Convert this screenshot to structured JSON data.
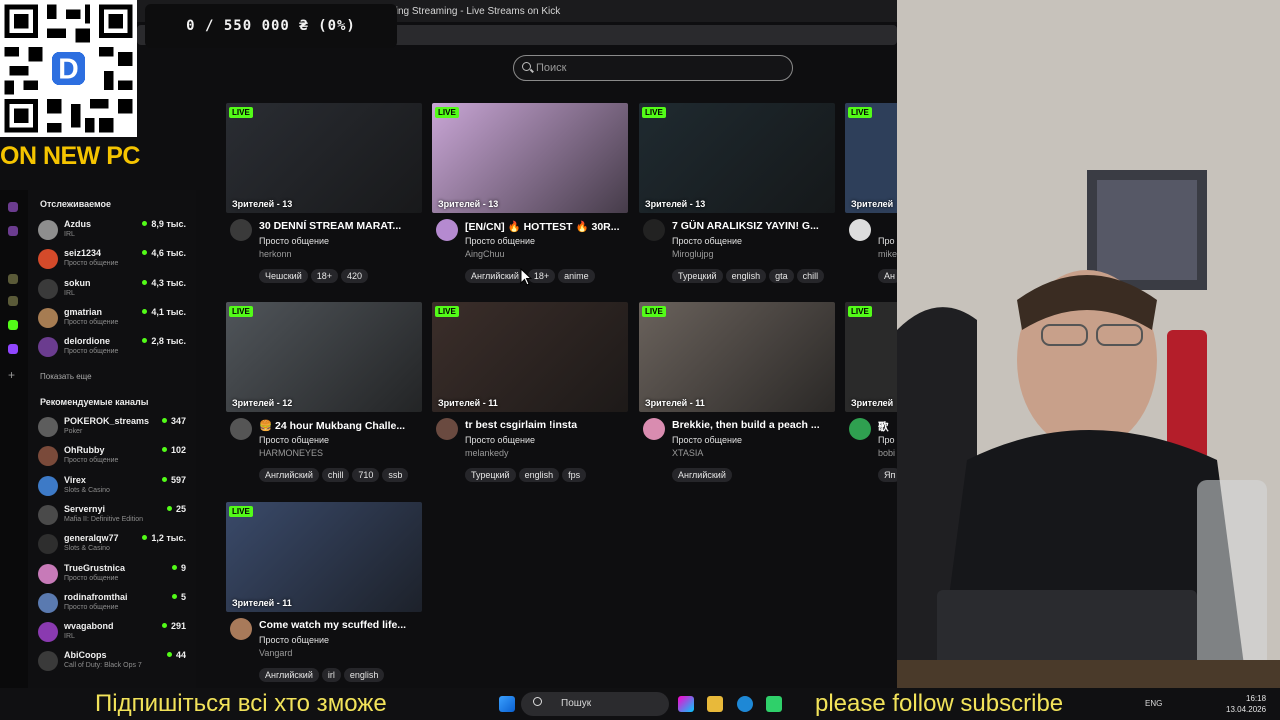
{
  "browser": {
    "window_title": "Just Chatting Streaming - Live Streams on Kick",
    "search_placeholder": "Поиск"
  },
  "overlay": {
    "donation_goal": "0 / 550 000 ₴ (0%)",
    "banner": "ON NEW PC",
    "qr_letter": "D",
    "subtitle_left": "Підпишіться всі хто зможе",
    "subtitle_right": "please follow subscribe"
  },
  "sidebar": {
    "following_heading": "Отслеживаемое",
    "show_more": "Показать еще",
    "recommended_heading": "Рекомендуемые каналы",
    "following": [
      {
        "name": "Azdus",
        "category": "IRL",
        "viewers": "8,9 тыс.",
        "color": "#8e8e8e"
      },
      {
        "name": "seiz1234",
        "category": "Просто общение",
        "viewers": "4,6 тыс.",
        "color": "#d44a2a"
      },
      {
        "name": "sokun",
        "category": "IRL",
        "viewers": "4,3 тыс.",
        "color": "#3a3a3a"
      },
      {
        "name": "gmatrian",
        "category": "Просто общение",
        "viewers": "4,1 тыс.",
        "color": "#a67c52"
      },
      {
        "name": "delordione",
        "category": "Просто общение",
        "viewers": "2,8 тыс.",
        "color": "#6b3c8f"
      }
    ],
    "recommended": [
      {
        "name": "POKEROK_streams",
        "category": "Poker",
        "viewers": "347",
        "color": "#5d5d5d"
      },
      {
        "name": "OhRubby",
        "category": "Просто общение",
        "viewers": "102",
        "color": "#7a4a3a"
      },
      {
        "name": "Virex",
        "category": "Slots & Casino",
        "viewers": "597",
        "color": "#3d7ac7"
      },
      {
        "name": "Servernyi",
        "category": "Mafia II: Definitive Edition",
        "viewers": "25",
        "color": "#4a4a4a"
      },
      {
        "name": "generalqw77",
        "category": "Slots & Casino",
        "viewers": "1,2 тыс.",
        "color": "#2e2e2e"
      },
      {
        "name": "TrueGrustnica",
        "category": "Просто общение",
        "viewers": "9",
        "color": "#c77ab8"
      },
      {
        "name": "rodinafromthai",
        "category": "Просто общение",
        "viewers": "5",
        "color": "#5a7ab0"
      },
      {
        "name": "wvagabond",
        "category": "IRL",
        "viewers": "291",
        "color": "#8a3ab0"
      },
      {
        "name": "AbiCoops",
        "category": "Call of Duty: Black Ops 7",
        "viewers": "44",
        "color": "#3a3a3a"
      }
    ]
  },
  "streams": [
    {
      "live": "LIVE",
      "viewers": "Зрителей - 13",
      "title": "30 DENNÍ STREAM MARAT...",
      "category": "Просто общение",
      "channel": "herkonn",
      "tags": [
        "Чешский",
        "18+",
        "420"
      ],
      "thumb_color": "#2a2d33",
      "avatar_color": "#3a3a3a"
    },
    {
      "live": "LIVE",
      "viewers": "Зрителей - 13",
      "title": "[EN/CN] 🔥 HOTTEST 🔥 30R...",
      "category": "Просто общение",
      "channel": "AingChuu",
      "tags": [
        "Английский",
        "18+",
        "anime"
      ],
      "thumb_color": "#c9a6d6",
      "avatar_color": "#b58ad0"
    },
    {
      "live": "LIVE",
      "viewers": "Зрителей - 13",
      "title": "7 GÜN ARALIKSIZ YAYIN! G...",
      "category": "Просто общение",
      "channel": "Miroglujpg",
      "tags": [
        "Турецкий",
        "english",
        "gta",
        "chill"
      ],
      "thumb_color": "#1f2a30",
      "avatar_color": "#222222"
    },
    {
      "live": "LIVE",
      "viewers": "Зрителей - 12",
      "title": "🍔 24 hour Mukbang Challe...",
      "category": "Просто общение",
      "channel": "HARMONEYES",
      "tags": [
        "Английский",
        "chill",
        "710",
        "ssb"
      ],
      "thumb_color": "#50555a",
      "avatar_color": "#555555"
    },
    {
      "live": "LIVE",
      "viewers": "Зрителей - 11",
      "title": "tr best csgirlaim !insta",
      "category": "Просто общение",
      "channel": "melankedy",
      "tags": [
        "Турецкий",
        "english",
        "fps"
      ],
      "thumb_color": "#3b2e2a",
      "avatar_color": "#6a4a40"
    },
    {
      "live": "LIVE",
      "viewers": "Зрителей - 11",
      "title": "Brekkie, then build a peach ...",
      "category": "Просто общение",
      "channel": "XTASIA",
      "tags": [
        "Английский"
      ],
      "thumb_color": "#6a625c",
      "avatar_color": "#d98cb0"
    },
    {
      "live": "LIVE",
      "viewers": "Зрителей - 11",
      "title": "Come watch my scuffed life...",
      "category": "Просто общение",
      "channel": "Vangard",
      "tags": [
        "Английский",
        "irl",
        "english"
      ],
      "thumb_color": "#3a4a6a",
      "avatar_color": "#a87a5a"
    }
  ],
  "partial_streams": [
    {
      "live": "LIVE",
      "viewers": "Зрителей",
      "title": "",
      "category": "Про",
      "channel": "mike",
      "tag": "Ан"
    },
    {
      "live": "LIVE",
      "viewers": "Зрителей",
      "title": "歌 ",
      "category": "Про",
      "channel": "bobi",
      "tag": "Яп"
    }
  ],
  "taskbar": {
    "search_label": "Пошук",
    "lang": "ENG",
    "time": "16:18",
    "date": "13.04.2026"
  },
  "colors": {
    "kick_green": "#53fc18",
    "subtitle_yellow": "#f2e35a",
    "banner_yellow": "#f5c400"
  }
}
